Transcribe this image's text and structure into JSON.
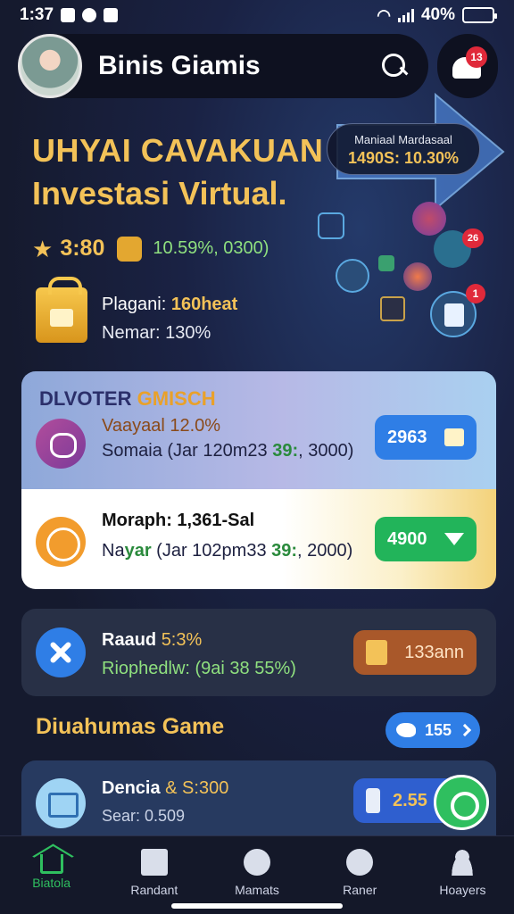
{
  "status_bar": {
    "time": "1:37",
    "battery": "40%",
    "battery_level": 0.4
  },
  "header": {
    "title": "Binis Giamis",
    "notification_count": "13"
  },
  "hero": {
    "title": "UHYAI CAVAKUAN",
    "subtitle": "Investasi Virtual.",
    "promo_label": "Maniaal Mardasaal",
    "promo_value": "1490S: 10.30%",
    "score": "3:80",
    "stat_detail": "10.59%, 0300)",
    "line1_label": "Plagani: ",
    "line1_value": "160heat",
    "line2": "Nemar: 130%",
    "icon_badge": "26",
    "calc_badge": "1"
  },
  "featured": {
    "title_main": "DLVOTER ",
    "title_accent": "GMISCH",
    "row1": {
      "line1": "Vaayaal 12.0%",
      "line2_a": "Somaia (Jar 120m23 ",
      "line2_hl": "39:",
      "line2_b": ", 3000)",
      "button": "2963"
    },
    "row2": {
      "line1": "Moraph: 1,361-Sal",
      "line2_a": "Na",
      "line2_hl": "yar",
      "line2_b": " (Jar 102pm33 ",
      "line2_hl2": "39:",
      "line2_c": ", 2000)",
      "button": "4900"
    }
  },
  "row3": {
    "title": "Raaud ",
    "title_accent": "5:3%",
    "line2": "Riophedlw: (9ai 38 55%)",
    "button": "133ann"
  },
  "games": {
    "title": "Diuahumas Game",
    "count": "155",
    "item": {
      "title": "Dencia ",
      "title_accent": "& S:300",
      "line2": "Sear: 0.509",
      "button": "2.55"
    }
  },
  "nav": [
    {
      "label": "Biatola",
      "icon": "home-icon"
    },
    {
      "label": "Randant",
      "icon": "document-icon"
    },
    {
      "label": "Mamats",
      "icon": "chat-icon"
    },
    {
      "label": "Raner",
      "icon": "chat-icon"
    },
    {
      "label": "Hoayers",
      "icon": "user-icon"
    }
  ],
  "colors": {
    "accent_gold": "#f3c258",
    "accent_green": "#2fbf5f",
    "accent_blue": "#2f7ee6",
    "background": "#161a2c"
  }
}
